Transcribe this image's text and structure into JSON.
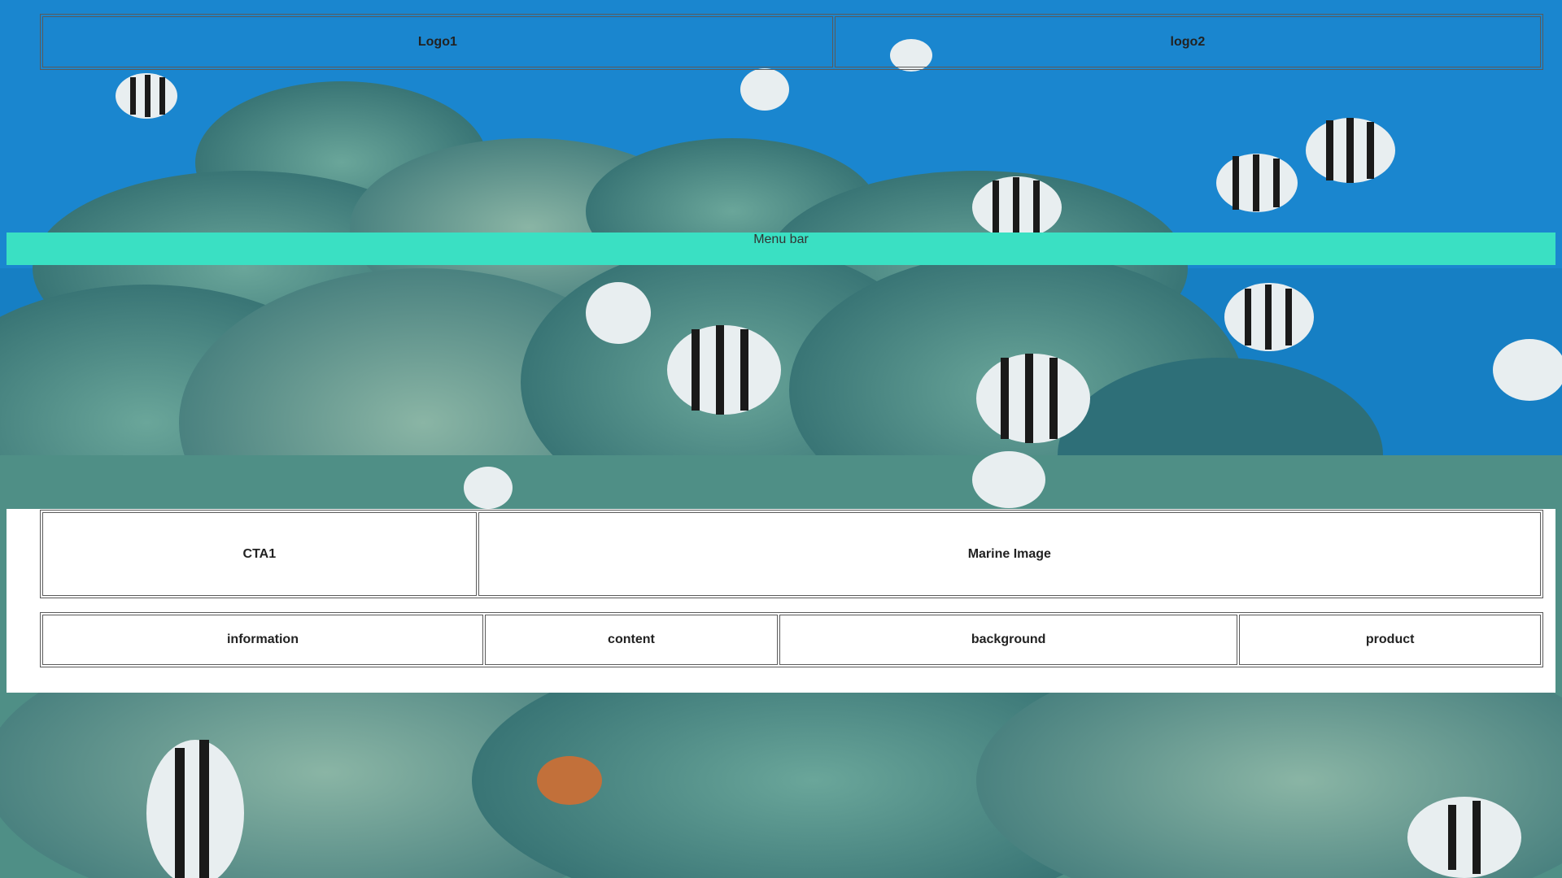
{
  "header": {
    "logo1": "Logo1",
    "logo2": "logo2"
  },
  "menu_bar": {
    "label": "Menu bar",
    "color": "#3ae0c3"
  },
  "hero": {
    "background_image": "underwater coral reef with striped sergeant-major fish"
  },
  "cta_section": {
    "cta1": "CTA1",
    "marine_image": "Marine Image"
  },
  "nav": {
    "items": [
      {
        "label": "information"
      },
      {
        "label": "content"
      },
      {
        "label": "background"
      },
      {
        "label": "product"
      }
    ]
  }
}
